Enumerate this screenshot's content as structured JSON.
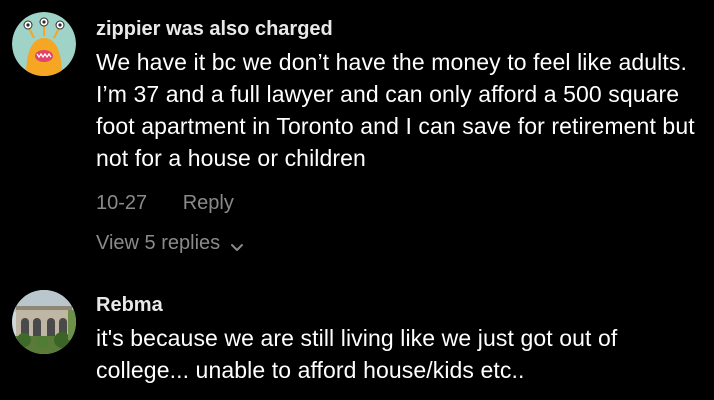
{
  "comments": [
    {
      "username": "zippier was also charged",
      "text": "We have it bc we don’t have the money to feel like adults. I’m 37 and a full lawyer and can only afford a 500 square foot apartment in Toronto and I can save for retirement but not for a house or children",
      "date": "10-27",
      "reply_label": "Reply",
      "view_replies_label": "View 5 replies",
      "avatar_icon": "monster-avatar-icon"
    },
    {
      "username": "Rebma",
      "text": "it's because we are still living like we just got out of college... unable to afford house/kids etc..",
      "avatar_icon": "building-photo-avatar-icon"
    }
  ],
  "colors": {
    "background": "#000000",
    "text": "#ffffff",
    "muted": "#8a8a8a",
    "avatar1_bg": "#9fd3c7",
    "avatar1_face": "#f5a623"
  }
}
